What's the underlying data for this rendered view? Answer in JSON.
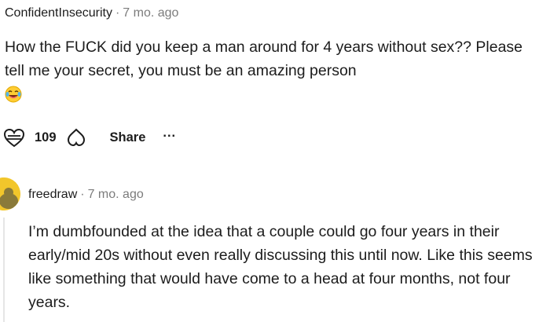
{
  "comment_1": {
    "author": "ConfidentInsecurity",
    "separator": "·",
    "age": "7 mo. ago",
    "body": "How the FUCK did you keep a man around for 4 years without sex?? Please tell me your secret, you must be an amazing person",
    "emoji": "laughing-tears-emoji",
    "votes": "109",
    "share_label": "Share",
    "more_label": "..."
  },
  "comment_2": {
    "author": "freedraw",
    "separator": "·",
    "age": "7 mo. ago",
    "body": "I’m dumbfounded at the idea that a couple could go four years in their early/mid 20s without even really discussing this until now. Like this seems like something that would have come to a head at four months, not four years."
  },
  "colors": {
    "text": "#1c1c1c",
    "meta": "#7c7c7c",
    "avatar": "#f2c62b",
    "thread_line": "#e5e5e5"
  }
}
